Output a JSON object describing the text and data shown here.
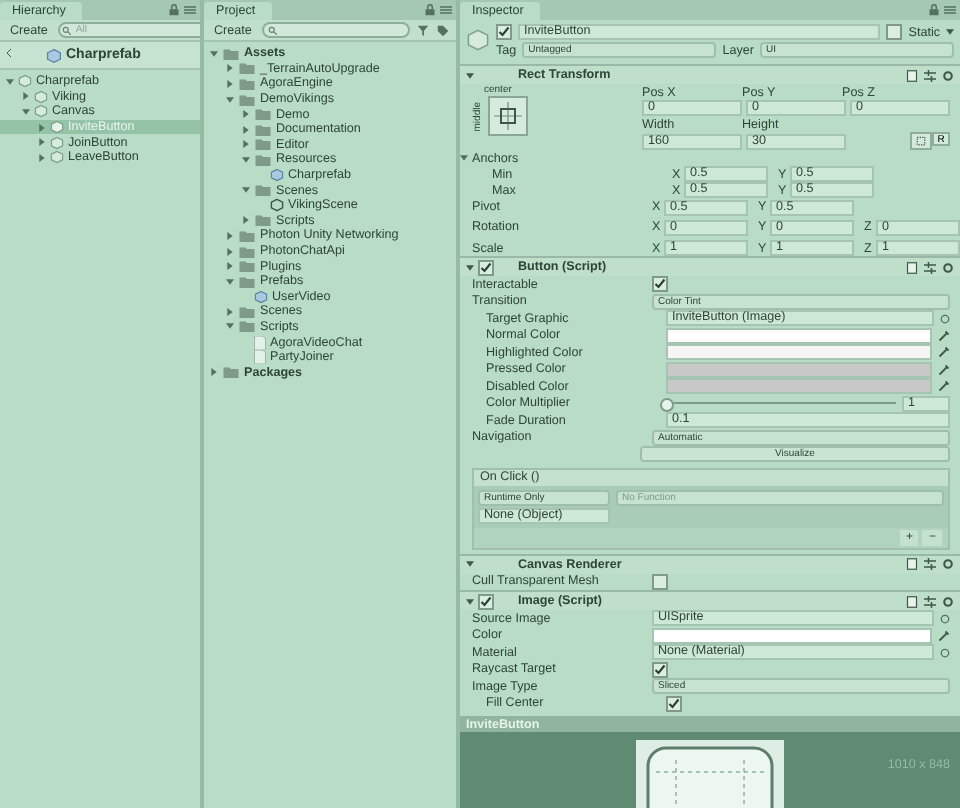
{
  "hierarchy": {
    "title": "Hierarchy",
    "create_label": "Create",
    "search_placeholder": "All",
    "prefab_title": "Charprefab",
    "tree": [
      {
        "label": "Charprefab",
        "expanded": true,
        "selected": false,
        "children": [
          {
            "label": "Viking",
            "expanded": false,
            "selected": false
          },
          {
            "label": "Canvas",
            "expanded": true,
            "selected": false,
            "children": [
              {
                "label": "InviteButton",
                "expanded": false,
                "selected": true
              },
              {
                "label": "JoinButton",
                "expanded": false,
                "selected": false
              },
              {
                "label": "LeaveButton",
                "expanded": false,
                "selected": false
              }
            ]
          }
        ]
      }
    ]
  },
  "project": {
    "title": "Project",
    "create_label": "Create",
    "tree": [
      {
        "label": "Assets",
        "kind": "folder",
        "bold": true,
        "expanded": true,
        "children": [
          {
            "label": "_TerrainAutoUpgrade",
            "kind": "folder",
            "expanded": false
          },
          {
            "label": "AgoraEngine",
            "kind": "folder",
            "expanded": false
          },
          {
            "label": "DemoVikings",
            "kind": "folder",
            "expanded": true,
            "children": [
              {
                "label": "Demo",
                "kind": "folder",
                "expanded": false
              },
              {
                "label": "Documentation",
                "kind": "folder",
                "expanded": false
              },
              {
                "label": "Editor",
                "kind": "folder",
                "expanded": false
              },
              {
                "label": "Resources",
                "kind": "folder",
                "expanded": true,
                "children": [
                  {
                    "label": "Charprefab",
                    "kind": "prefab"
                  }
                ]
              },
              {
                "label": "Scenes",
                "kind": "folder",
                "expanded": true,
                "children": [
                  {
                    "label": "VikingScene",
                    "kind": "scene"
                  }
                ]
              },
              {
                "label": "Scripts",
                "kind": "folder",
                "expanded": false
              }
            ]
          },
          {
            "label": "Photon Unity Networking",
            "kind": "folder",
            "expanded": false
          },
          {
            "label": "PhotonChatApi",
            "kind": "folder",
            "expanded": false
          },
          {
            "label": "Plugins",
            "kind": "folder",
            "expanded": false
          },
          {
            "label": "Prefabs",
            "kind": "folder",
            "expanded": true,
            "children": [
              {
                "label": "UserVideo",
                "kind": "prefab"
              }
            ]
          },
          {
            "label": "Scenes",
            "kind": "folder",
            "expanded": false
          },
          {
            "label": "Scripts",
            "kind": "folder",
            "expanded": true,
            "children": [
              {
                "label": "AgoraVideoChat",
                "kind": "script"
              },
              {
                "label": "PartyJoiner",
                "kind": "script"
              }
            ]
          }
        ]
      },
      {
        "label": "Packages",
        "kind": "folder",
        "bold": true,
        "expanded": false
      }
    ]
  },
  "inspector": {
    "title": "Inspector",
    "object_name": "InviteButton",
    "active": true,
    "static_label": "Static",
    "static": false,
    "tag_label": "Tag",
    "tag_value": "Untagged",
    "layer_label": "Layer",
    "layer_value": "UI",
    "rect_transform": {
      "title": "Rect Transform",
      "anchor_h": "center",
      "anchor_v": "middle",
      "pos_labels": [
        "Pos X",
        "Pos Y",
        "Pos Z"
      ],
      "pos_values": [
        "0",
        "0",
        "0"
      ],
      "size_labels": [
        "Width",
        "Height"
      ],
      "size_values": [
        "160",
        "30"
      ],
      "raw_button": "R",
      "anchors_label": "Anchors",
      "anchors_expanded": true,
      "anchor_rows": [
        {
          "label": "Min",
          "fields": [
            {
              "axis": "X",
              "value": "0.5"
            },
            {
              "axis": "Y",
              "value": "0.5"
            }
          ]
        },
        {
          "label": "Max",
          "fields": [
            {
              "axis": "X",
              "value": "0.5"
            },
            {
              "axis": "Y",
              "value": "0.5"
            }
          ]
        }
      ],
      "vector_rows": [
        {
          "label": "Pivot",
          "fields": [
            {
              "axis": "X",
              "value": "0.5"
            },
            {
              "axis": "Y",
              "value": "0.5"
            }
          ]
        },
        {
          "label": "Rotation",
          "fields": [
            {
              "axis": "X",
              "value": "0"
            },
            {
              "axis": "Y",
              "value": "0"
            },
            {
              "axis": "Z",
              "value": "0"
            }
          ]
        },
        {
          "label": "Scale",
          "fields": [
            {
              "axis": "X",
              "value": "1"
            },
            {
              "axis": "Y",
              "value": "1"
            },
            {
              "axis": "Z",
              "value": "1"
            }
          ]
        }
      ]
    },
    "button": {
      "title": "Button (Script)",
      "enabled": true,
      "props": [
        {
          "kind": "checkbox",
          "label": "Interactable",
          "checked": true
        },
        {
          "kind": "dropdown",
          "label": "Transition",
          "value": "Color Tint",
          "children": [
            {
              "kind": "object",
              "label": "Target Graphic",
              "value": "InviteButton (Image)"
            },
            {
              "kind": "color",
              "label": "Normal Color",
              "color": "#ffffff"
            },
            {
              "kind": "color",
              "label": "Highlighted Color",
              "color": "#f5f5f5"
            },
            {
              "kind": "color",
              "label": "Pressed Color",
              "color": "#c8c8c8"
            },
            {
              "kind": "color",
              "label": "Disabled Color",
              "color": "#c8c8c8"
            },
            {
              "kind": "slider",
              "label": "Color Multiplier",
              "level": 0,
              "reading": "1"
            },
            {
              "kind": "number",
              "label": "Fade Duration",
              "value": "0.1"
            }
          ]
        },
        {
          "kind": "dropdown",
          "label": "Navigation",
          "value": "Automatic"
        },
        {
          "kind": "button",
          "label": "Visualize"
        }
      ],
      "event": {
        "title": "On Click ()",
        "runtime": "Runtime Only",
        "function": "No Function",
        "object": "None (Object)",
        "add": "+",
        "remove": "−"
      }
    },
    "canvas_renderer": {
      "title": "Canvas Renderer",
      "props": [
        {
          "kind": "checkbox",
          "label": "Cull Transparent Mesh",
          "checked": false
        }
      ]
    },
    "image": {
      "title": "Image (Script)",
      "enabled": true,
      "props": [
        {
          "kind": "object",
          "label": "Source Image",
          "value": "UISprite"
        },
        {
          "kind": "color",
          "label": "Color",
          "color": "#ffffff"
        },
        {
          "kind": "object",
          "label": "Material",
          "value": "None (Material)"
        },
        {
          "kind": "checkbox",
          "label": "Raycast Target",
          "checked": true
        },
        {
          "kind": "dropdown",
          "label": "Image Type",
          "value": "Sliced",
          "children": [
            {
              "kind": "checkbox",
              "label": "Fill Center",
              "checked": true
            }
          ]
        }
      ]
    },
    "preview": {
      "title": "InviteButton",
      "size": "1010 x 848"
    }
  }
}
